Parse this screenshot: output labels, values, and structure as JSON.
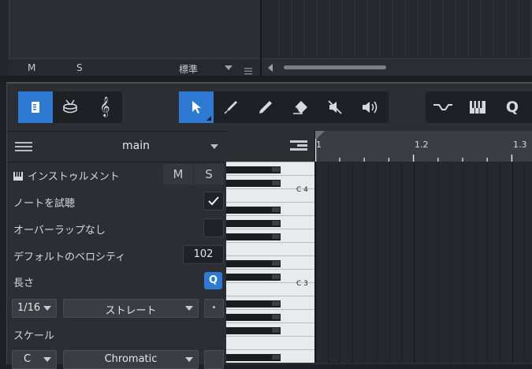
{
  "top_panel": {
    "mute_label": "M",
    "solo_label": "S",
    "preset": "標準"
  },
  "toolbar": {
    "left_group": [
      {
        "icon": "inspector-icon",
        "active": true
      },
      {
        "icon": "drum-icon",
        "active": false
      },
      {
        "icon": "treble-clef-icon",
        "active": false
      }
    ],
    "tools": [
      {
        "icon": "arrow-tool-icon",
        "active": true
      },
      {
        "icon": "paint-tool-icon",
        "active": false
      },
      {
        "icon": "pencil-tool-icon",
        "active": false
      },
      {
        "icon": "eraser-tool-icon",
        "active": false
      },
      {
        "icon": "mute-tool-icon",
        "active": false
      },
      {
        "icon": "listen-tool-icon",
        "active": false
      }
    ],
    "right_group": [
      {
        "icon": "automation-icon"
      },
      {
        "icon": "piano-view-icon"
      },
      {
        "icon": "quantize-icon",
        "label": "Q"
      }
    ]
  },
  "inspector": {
    "header_title": "main",
    "instrument_label": "インストゥルメント",
    "instrument_mute": "M",
    "instrument_solo": "S",
    "audition_label": "ノートを試聴",
    "audition_checked": true,
    "no_overlap_label": "オーバーラップなし",
    "no_overlap_checked": false,
    "velocity_label": "デフォルトのベロシティ",
    "velocity_value": "102",
    "length_label": "長さ",
    "length_q": "Q",
    "length_value": "1/16",
    "length_type": "ストレート",
    "length_dot": "•",
    "scale_label": "スケール",
    "scale_root": "C",
    "scale_type": "Chromatic"
  },
  "piano": {
    "labels": [
      "C 4",
      "C 3"
    ]
  },
  "ruler": {
    "bars": [
      "1",
      "1.2",
      "1.3"
    ]
  },
  "colors": {
    "accent": "#2e79d4",
    "panel": "#2b2e33",
    "background": "#1e2125"
  }
}
